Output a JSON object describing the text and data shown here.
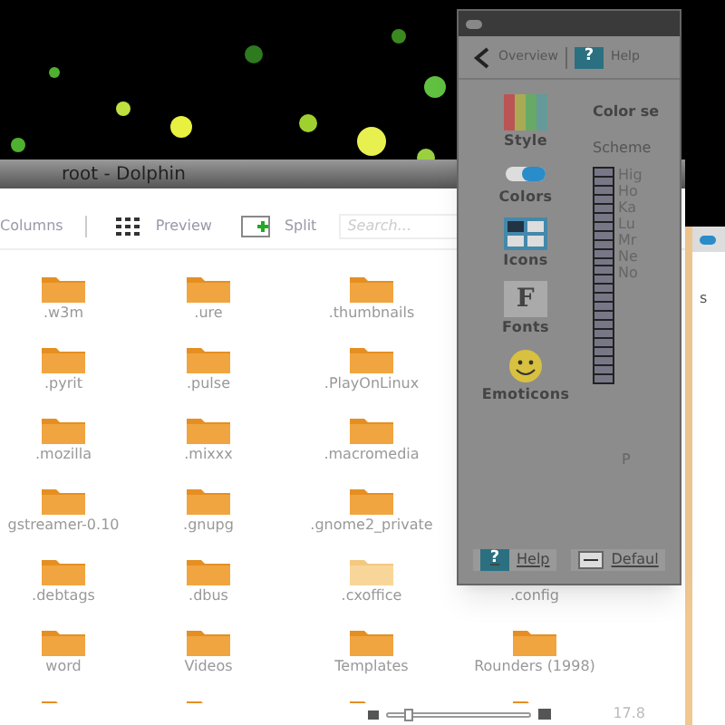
{
  "dolphin": {
    "title": "root - Dolphin",
    "toolbar": [
      {
        "kind": "columns",
        "label": "Columns"
      },
      {
        "kind": "preview",
        "label": "Preview"
      },
      {
        "kind": "split",
        "label": "Split"
      }
    ],
    "search": {
      "placeholder": "Search..."
    },
    "rows": [
      [
        {
          "label": ".w3m"
        },
        {
          "label": ".ure"
        },
        {
          "label": ".thumbnails"
        }
      ],
      [
        {
          "label": ".pyrit"
        },
        {
          "label": ".pulse"
        },
        {
          "label": ".PlayOnLinux"
        }
      ],
      [
        {
          "label": ".mozilla"
        },
        {
          "label": ".mixxx"
        },
        {
          "label": ".macromedia"
        }
      ],
      [
        {
          "label": "gstreamer-0.10"
        },
        {
          "label": ".gnupg"
        },
        {
          "label": ".gnome2_private"
        }
      ],
      [
        {
          "label": ".debtags"
        },
        {
          "label": ".dbus"
        },
        {
          "label": ".cxoffice"
        },
        {
          "label": ".config"
        }
      ],
      [
        {
          "label": "word"
        },
        {
          "label": "Videos"
        },
        {
          "label": "Templates"
        },
        {
          "label": "Rounders (1998)"
        }
      ],
      [
        {},
        {},
        {},
        {}
      ]
    ],
    "zoom": {
      "level": 0.12
    },
    "status": "17.8"
  },
  "settings": {
    "toolbar": [
      {
        "kind": "back",
        "label": "Overview"
      },
      {
        "kind": "help",
        "label": "Help",
        "glyph": "?"
      }
    ],
    "sidebar": [
      {
        "kind": "style",
        "label": "Style"
      },
      {
        "kind": "colors",
        "label": "Colors"
      },
      {
        "kind": "icons",
        "label": "Icons"
      },
      {
        "kind": "fonts",
        "label": "Fonts",
        "glyph": "F"
      },
      {
        "kind": "emoticons",
        "label": "Emoticons"
      }
    ],
    "heading": "Color se",
    "scheme_label": "Scheme",
    "schemes": [
      "Hig",
      "Ho",
      "Ka",
      "Lu",
      "Mr",
      "Ne",
      "No"
    ],
    "preview_label": "P",
    "buttons": [
      {
        "kind": "help",
        "label": "Help",
        "glyph": "?"
      },
      {
        "kind": "defaults",
        "label": "Defaul"
      }
    ]
  },
  "dialog": {
    "text": "s"
  }
}
